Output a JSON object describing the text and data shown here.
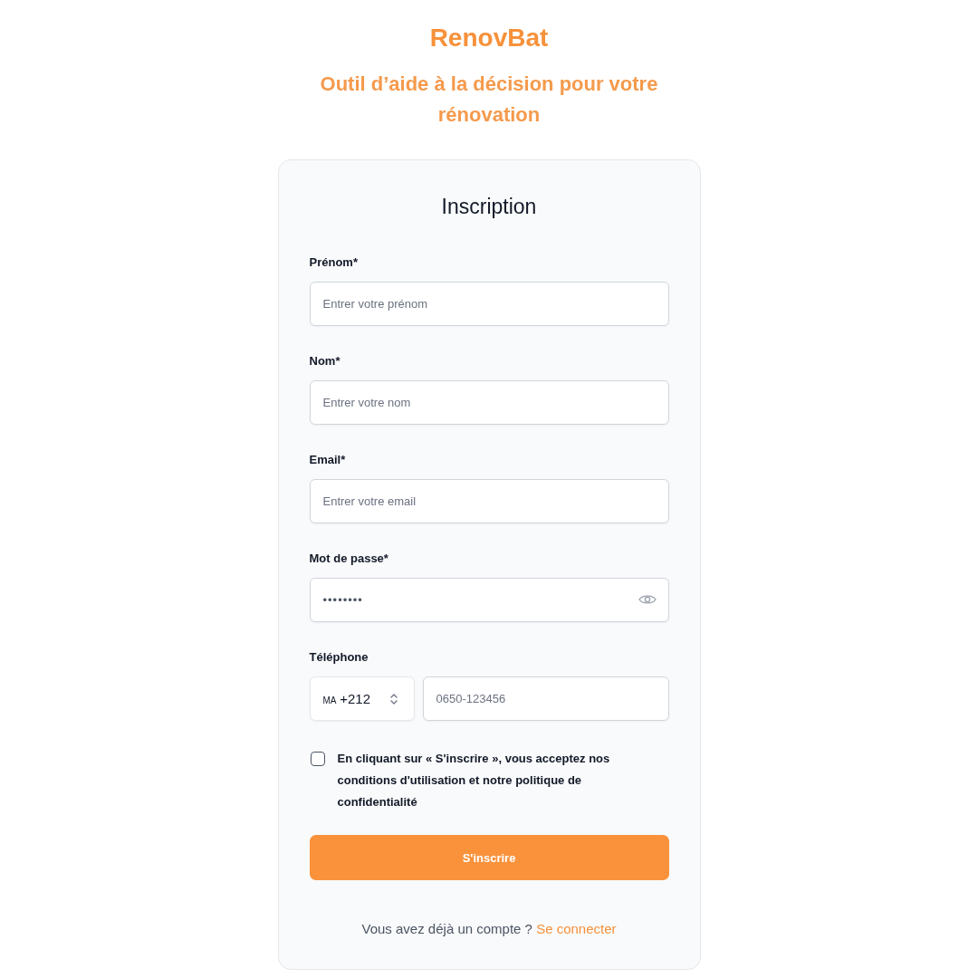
{
  "header": {
    "brand": "RenovBat",
    "tagline": "Outil d’aide à la décision pour votre rénovation"
  },
  "form": {
    "title": "Inscription",
    "fields": [
      {
        "kind": "text",
        "label": "Prénom*",
        "placeholder": "Entrer votre prénom"
      },
      {
        "kind": "text",
        "label": "Nom*",
        "placeholder": "Entrer votre nom"
      },
      {
        "kind": "email",
        "label": "Email*",
        "placeholder": "Entrer votre email"
      },
      {
        "kind": "password",
        "label": "Mot de passe*",
        "value": "••••••••"
      },
      {
        "kind": "phone",
        "label": "Téléphone",
        "country_code": "MA",
        "dial_code": "+212",
        "placeholder": "0650-123456"
      }
    ],
    "consent": {
      "checked": false,
      "text": "En cliquant sur « S'inscrire », vous acceptez nos conditions d'utilisation et notre politique de confidentialité"
    },
    "submit": "S'inscrire",
    "footer": {
      "text": "Vous avez déjà un compte ?",
      "link": "Se connecter"
    }
  }
}
